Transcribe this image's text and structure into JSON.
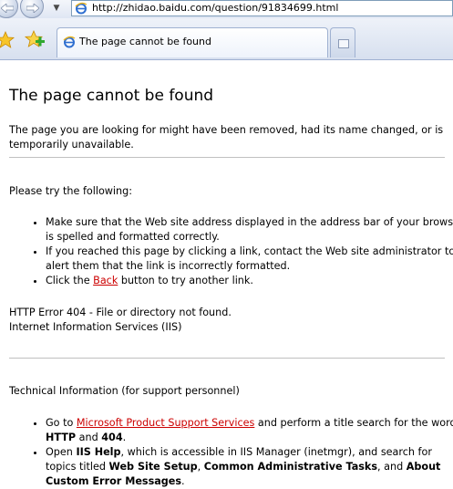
{
  "browser": {
    "url": "http://zhidao.baidu.com/question/91834699.html",
    "tab_title": "The page cannot be found"
  },
  "page": {
    "title": "The page cannot be found",
    "intro": "The page you are looking for might have been removed, had its name changed, or is temporarily unavailable.",
    "try_heading": "Please try the following:",
    "try_items": {
      "item1": "Make sure that the Web site address displayed in the address bar of your browser is spelled and formatted correctly.",
      "item2": "If you reached this page by clicking a link, contact the Web site administrator to alert them that the link is incorrectly formatted.",
      "item3_pre": "Click the ",
      "item3_link": "Back",
      "item3_post": " button to try another link."
    },
    "error_line": "HTTP Error 404 - File or directory not found.",
    "server_line": "Internet Information Services (IIS)",
    "tech_heading": "Technical Information (for support personnel)",
    "tech_items": {
      "item1_pre": "Go to ",
      "item1_link": "Microsoft Product Support Services",
      "item1_mid": " and perform a title search for the words ",
      "item1_b1": "HTTP",
      "item1_and": " and ",
      "item1_b2": "404",
      "item1_end": ".",
      "item2_pre": "Open ",
      "item2_b1": "IIS Help",
      "item2_mid": ", which is accessible in IIS Manager (inetmgr), and search for topics titled ",
      "item2_b2": "Web Site Setup",
      "item2_comma": ", ",
      "item2_b3": "Common Administrative Tasks",
      "item2_and": ", and ",
      "item2_b4": "About Custom Error Messages",
      "item2_end": "."
    }
  }
}
